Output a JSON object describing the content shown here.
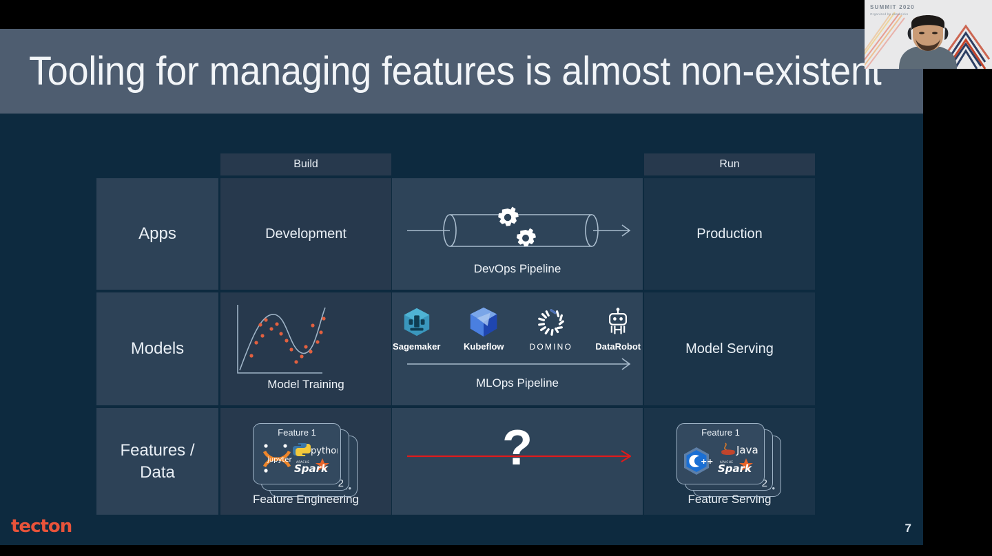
{
  "slide": {
    "title": "Tooling for managing features is almost non-existent",
    "page_number": "7",
    "brand": "tecton",
    "brand_color": "#e8533a",
    "title_band_color": "#4e5d70",
    "background_color": "#0d2a3f"
  },
  "matrix": {
    "column_headers": {
      "build": "Build",
      "run": "Run"
    },
    "rows": [
      {
        "label": "Apps",
        "build": "Development",
        "middle_caption": "DevOps Pipeline",
        "run": "Production"
      },
      {
        "label": "Models",
        "build_caption": "Model Training",
        "middle_caption": "MLOps Pipeline",
        "run": "Model Serving",
        "tools": [
          {
            "name": "Sagemaker",
            "icon": "sagemaker-icon"
          },
          {
            "name": "Kubeflow",
            "icon": "kubeflow-icon"
          },
          {
            "name": "DOMINO",
            "icon": "domino-icon"
          },
          {
            "name": "DataRobot",
            "icon": "datarobot-icon"
          }
        ]
      },
      {
        "label": "Features /\nData",
        "label_line1": "Features /",
        "label_line2": "Data",
        "build_caption": "Feature Engineering",
        "run_caption": "Feature Serving",
        "middle_marker": "?",
        "engineering_card": {
          "title": "Feature 1",
          "second_card": "2",
          "third_card": "•••",
          "logos": [
            "jupyter",
            "python",
            "Spark"
          ]
        },
        "serving_card": {
          "title": "Feature 1",
          "second_card": "2",
          "third_card": "•••",
          "logos": [
            "C++",
            "Java",
            "Spark"
          ]
        }
      }
    ]
  },
  "webcam": {
    "summit_title": "SUMMIT 2020",
    "summit_subtitle": "Organized by databricks"
  }
}
